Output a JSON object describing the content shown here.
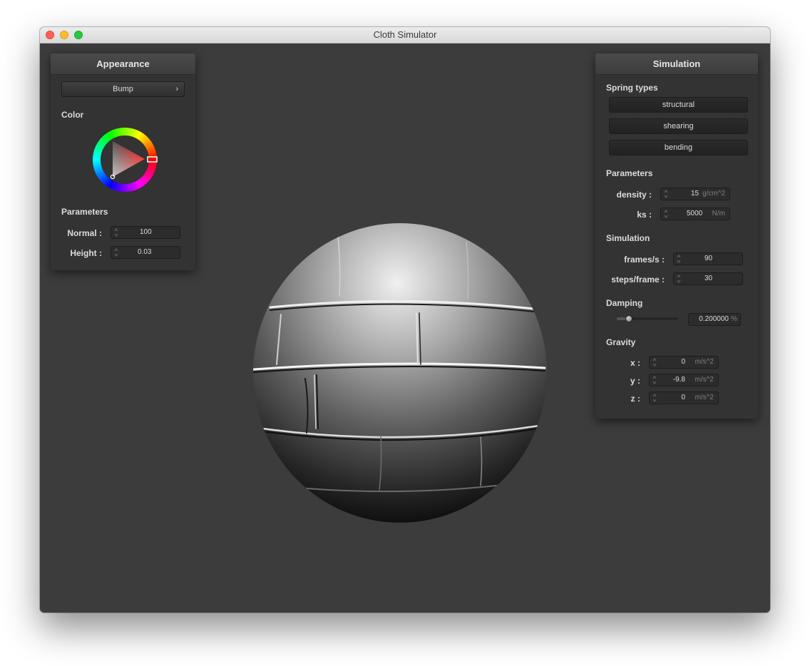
{
  "window": {
    "title": "Cloth Simulator"
  },
  "appearance": {
    "title": "Appearance",
    "shader_dropdown": "Bump",
    "color_label": "Color",
    "color_value": "#ff2a2a",
    "parameters_label": "Parameters",
    "normal": {
      "label": "Normal :",
      "value": "100"
    },
    "height": {
      "label": "Height :",
      "value": "0.03"
    }
  },
  "simulation": {
    "title": "Simulation",
    "spring_types_label": "Spring types",
    "spring_buttons": [
      "structural",
      "shearing",
      "bending"
    ],
    "parameters_label": "Parameters",
    "density": {
      "label": "density :",
      "value": "15",
      "unit": "g/cm^2"
    },
    "ks": {
      "label": "ks :",
      "value": "5000",
      "unit": "N/m"
    },
    "sim_label": "Simulation",
    "frames": {
      "label": "frames/s :",
      "value": "90"
    },
    "steps": {
      "label": "steps/frame :",
      "value": "30"
    },
    "damping_label": "Damping",
    "damping": {
      "value": "0.200000",
      "unit": "%",
      "fraction": 0.2
    },
    "gravity_label": "Gravity",
    "gravity_x": {
      "label": "x :",
      "value": "0",
      "unit": "m/s^2"
    },
    "gravity_y": {
      "label": "y :",
      "value": "-9.8",
      "unit": "m/s^2"
    },
    "gravity_z": {
      "label": "z :",
      "value": "0",
      "unit": "m/s^2"
    }
  }
}
